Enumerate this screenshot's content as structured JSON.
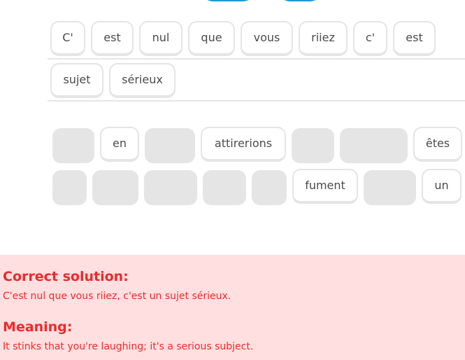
{
  "answer_tiles": [
    "C'",
    "est",
    "nul",
    "que",
    "vous",
    "riiez",
    "c'",
    "est",
    "sujet",
    "sérieux"
  ],
  "word_bank": {
    "row1": [
      {
        "label": "",
        "used": true
      },
      {
        "label": "en",
        "used": false
      },
      {
        "label": "",
        "used": true
      },
      {
        "label": "attirerions",
        "used": false
      },
      {
        "label": "",
        "used": true
      },
      {
        "label": "",
        "used": true
      },
      {
        "label": "êtes",
        "used": false
      }
    ],
    "row2": [
      {
        "label": "",
        "used": true
      },
      {
        "label": "",
        "used": true
      },
      {
        "label": "",
        "used": true
      },
      {
        "label": "",
        "used": true
      },
      {
        "label": "",
        "used": true
      },
      {
        "label": "fument",
        "used": false
      },
      {
        "label": "",
        "used": true
      },
      {
        "label": "un",
        "used": false
      }
    ]
  },
  "feedback": {
    "solution_heading": "Correct solution:",
    "solution_text": "C'est nul que vous riiez, c'est un sujet sérieux.",
    "meaning_heading": "Meaning:",
    "meaning_text": "It stinks that you're laughing; it's a serious subject."
  },
  "colors": {
    "tile_border": "#e5e5e5",
    "slot_fill": "#e5e5e5",
    "feedback_bg": "#ffdfe0",
    "feedback_text": "#ea2b2b",
    "button_blue": "#1899d6"
  }
}
